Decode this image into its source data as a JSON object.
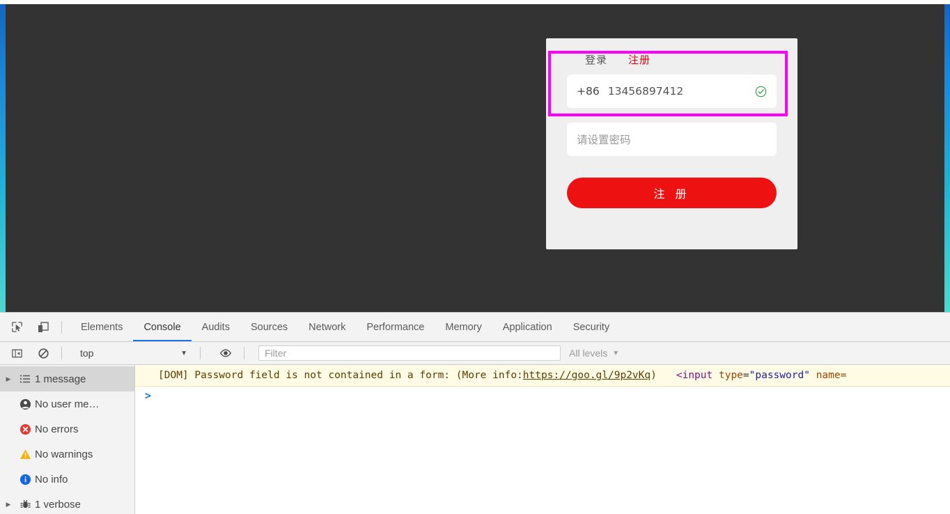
{
  "page": {
    "overlay_color": "#333333",
    "background_gradient_from": "#1565c0",
    "background_gradient_to": "#4fd8d0"
  },
  "register_card": {
    "tab_login": "登录",
    "tab_register": "注册",
    "phone_prefix": "+86",
    "phone_number": "13456897412",
    "phone_valid_icon": "check-circle-icon",
    "password_placeholder": "请设置密码",
    "submit_label": "注 册",
    "submit_color": "#ee1111",
    "card_bg": "#efefef"
  },
  "inspector": {
    "highlight_color": "#ff00ff"
  },
  "devtools": {
    "toolbar_icons": [
      {
        "name": "inspect-element-icon",
        "title": "Select an element in the page to inspect it"
      },
      {
        "name": "device-toolbar-icon",
        "title": "Toggle device toolbar"
      }
    ],
    "tabs": [
      {
        "label": "Elements",
        "active": false
      },
      {
        "label": "Console",
        "active": true
      },
      {
        "label": "Audits",
        "active": false
      },
      {
        "label": "Sources",
        "active": false
      },
      {
        "label": "Network",
        "active": false
      },
      {
        "label": "Performance",
        "active": false
      },
      {
        "label": "Memory",
        "active": false
      },
      {
        "label": "Application",
        "active": false
      },
      {
        "label": "Security",
        "active": false
      }
    ],
    "filterbar": {
      "sidebar_toggle_icon": "show-console-sidebar-icon",
      "clear_icon": "clear-console-icon",
      "context": "top",
      "context_caret": "▼",
      "eye_icon": "live-expressions-eye-icon",
      "filter_placeholder": "Filter",
      "filter_value": "",
      "levels": "All levels",
      "levels_caret": "▼"
    },
    "sidebar": [
      {
        "label": "1 message",
        "icon": "list-icon",
        "arrow": "▶",
        "selected": true
      },
      {
        "label": "No user me…",
        "icon": "user-icon",
        "arrow": "",
        "selected": false
      },
      {
        "label": "No errors",
        "icon": "error-icon",
        "arrow": "",
        "selected": false
      },
      {
        "label": "No warnings",
        "icon": "warning-icon",
        "arrow": "",
        "selected": false
      },
      {
        "label": "No info",
        "icon": "info-icon",
        "arrow": "",
        "selected": false
      },
      {
        "label": "1 verbose",
        "icon": "bug-icon",
        "arrow": "▶",
        "selected": false
      }
    ],
    "message": {
      "text_before_link": "[DOM] Password field is not contained in a form: (More info: ",
      "link": "https://goo.gl/9p2vKq",
      "text_after_link": ")",
      "code_open": "<input",
      "code_attr1": "type",
      "code_eq": "=",
      "code_val1": "\"password\"",
      "code_attr2": "name="
    },
    "prompt_symbol": ">"
  }
}
